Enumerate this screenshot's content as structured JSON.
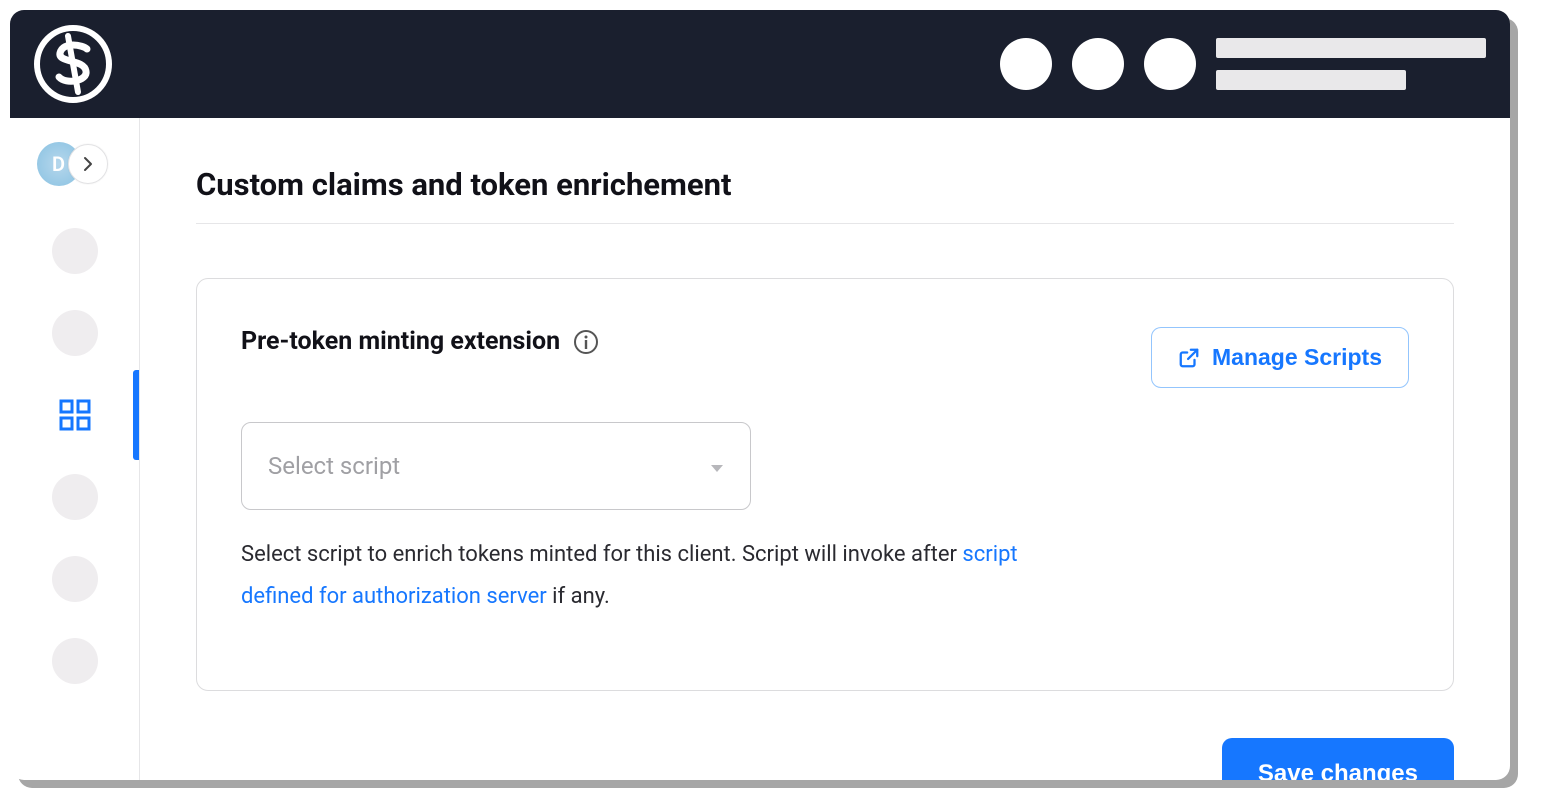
{
  "sidebar": {
    "avatar_letter": "D"
  },
  "page": {
    "title": "Custom claims and token enrichement"
  },
  "card": {
    "title": "Pre-token minting extension",
    "manage_label": "Manage Scripts",
    "select_placeholder": "Select script",
    "help_text_before": "Select script to enrich tokens minted for this client. Script will invoke after ",
    "help_link_text": "script defined for authorization server",
    "help_text_after": " if any."
  },
  "actions": {
    "save_label": "Save changes"
  }
}
